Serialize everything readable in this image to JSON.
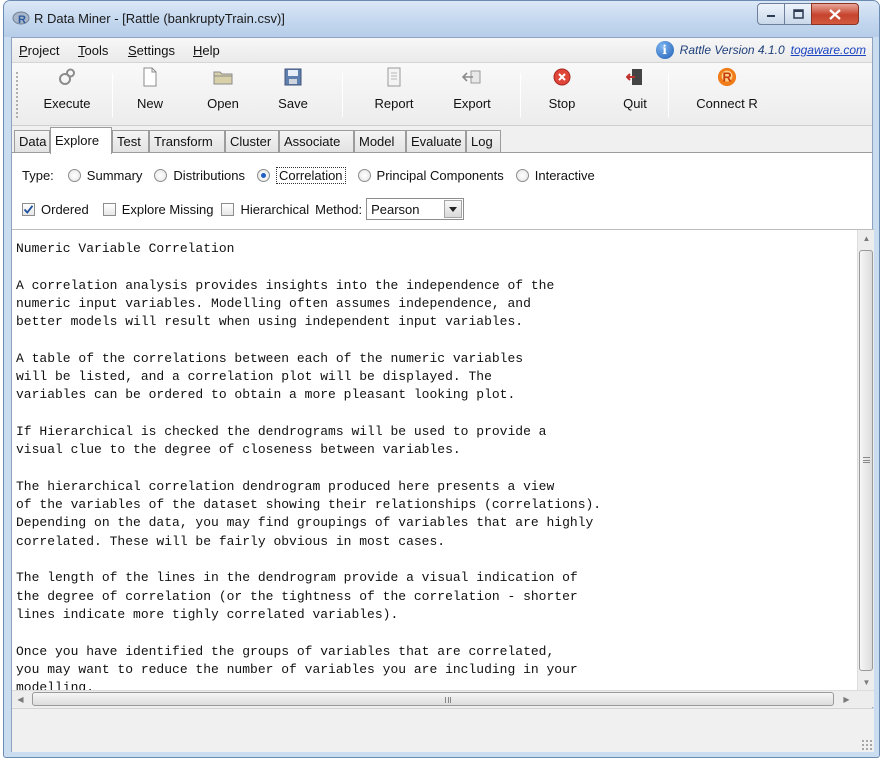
{
  "window": {
    "title": "R Data Miner - [Rattle (bankruptyTrain.csv)]"
  },
  "menubar": {
    "items": [
      {
        "pre": "",
        "ul": "P",
        "post": "roject"
      },
      {
        "pre": "",
        "ul": "T",
        "post": "ools"
      },
      {
        "pre": "",
        "ul": "S",
        "post": "ettings"
      },
      {
        "pre": "",
        "ul": "H",
        "post": "elp"
      }
    ],
    "version_text": "Rattle Version 4.1.0",
    "version_link": "togaware.com"
  },
  "toolbar": {
    "execute": "Execute",
    "new": "New",
    "open": "Open",
    "save": "Save",
    "report": "Report",
    "export": "Export",
    "stop": "Stop",
    "quit": "Quit",
    "connect_r": "Connect R"
  },
  "tabs": [
    "Data",
    "Explore",
    "Test",
    "Transform",
    "Cluster",
    "Associate",
    "Model",
    "Evaluate",
    "Log"
  ],
  "explore": {
    "type_label": "Type:",
    "types": [
      "Summary",
      "Distributions",
      "Correlation",
      "Principal Components",
      "Interactive"
    ],
    "selected_type": "Correlation",
    "ordered_label": "Ordered",
    "ordered_checked": true,
    "explore_missing_label": "Explore Missing",
    "explore_missing_checked": false,
    "hierarchical_label": "Hierarchical",
    "hierarchical_checked": false,
    "method_label": "Method:",
    "method_value": "Pearson"
  },
  "output_text": "Numeric Variable Correlation\n\nA correlation analysis provides insights into the independence of the\nnumeric input variables. Modelling often assumes independence, and\nbetter models will result when using independent input variables.\n\nA table of the correlations between each of the numeric variables\nwill be listed, and a correlation plot will be displayed. The\nvariables can be ordered to obtain a more pleasant looking plot.\n\nIf Hierarchical is checked the dendrograms will be used to provide a\nvisual clue to the degree of closeness between variables.\n\nThe hierarchical correlation dendrogram produced here presents a view\nof the variables of the dataset showing their relationships (correlations).\nDepending on the data, you may find groupings of variables that are highly\ncorrelated. These will be fairly obvious in most cases.\n\nThe length of the lines in the dendrogram provide a visual indication of\nthe degree of correlation (or the tightness of the correlation - shorter\nlines indicate more tighly correlated variables).\n\nOnce you have identified the groups of variables that are correlated,\nyou may want to reduce the number of variables you are including in your\nmodelling.",
  "icons": {
    "execute": "gears-icon",
    "new": "new-document-icon",
    "open": "open-folder-icon",
    "save": "floppy-disk-icon",
    "report": "report-icon",
    "export": "export-icon",
    "stop": "stop-icon",
    "quit": "quit-icon",
    "connect_r": "r-logo-icon"
  },
  "colors": {
    "stop_red": "#e0453a",
    "r_orange": "#f07c1a",
    "radio_dot": "#1e5ec6",
    "link_blue": "#1a44c0"
  }
}
